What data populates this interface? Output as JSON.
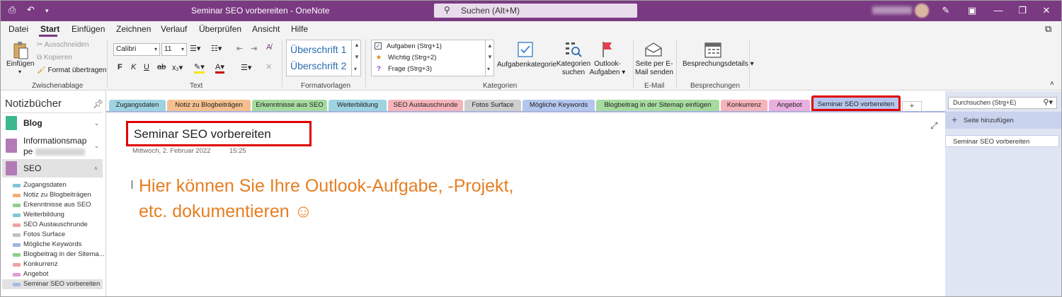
{
  "window": {
    "title": "Seminar SEO vorbereiten  -  OneNote",
    "search_label": "Suchen (Alt+M)"
  },
  "menu": [
    "Datei",
    "Start",
    "Einfügen",
    "Zeichnen",
    "Verlauf",
    "Überprüfen",
    "Ansicht",
    "Hilfe"
  ],
  "ribbon": {
    "clipboard": {
      "paste": "Einfügen",
      "cut": "Ausschneiden",
      "copy": "Kopieren",
      "format_painter": "Format übertragen",
      "group": "Zwischenablage"
    },
    "text": {
      "font": "Calibri",
      "size": "11",
      "group": "Text"
    },
    "styles": {
      "heading1": "Überschrift 1",
      "heading2": "Überschrift 2",
      "group": "Formatvorlagen"
    },
    "tags": {
      "items": [
        "Aufgaben (Strg+1)",
        "Wichtig (Strg+2)",
        "Frage (Strg+3)"
      ],
      "task_tag": "Aufgabenkategorie",
      "find_tags_1": "Kategorien",
      "find_tags_2": "suchen",
      "outlook_1": "Outlook-",
      "outlook_2": "Aufgaben",
      "group": "Kategorien"
    },
    "email": {
      "send_1": "Seite per E-",
      "send_2": "Mail senden",
      "group": "E-Mail"
    },
    "meetings": {
      "details": "Besprechungsdetails",
      "group": "Besprechungen"
    }
  },
  "notebooks": {
    "title": "Notizbücher",
    "items": [
      {
        "name": "Blog",
        "color": "#3cb88f"
      },
      {
        "name_1": "Informationsmap",
        "name_2": "pe",
        "color": "#b27bb6"
      },
      {
        "name": "SEO",
        "color": "#b27bb6"
      }
    ],
    "sections": [
      {
        "label": "Zugangsdaten",
        "color": "#7fc7d9"
      },
      {
        "label": "Notiz zu Blogbeiträgen",
        "color": "#f0b07a"
      },
      {
        "label": "Erkenntnisse aus SEO",
        "color": "#8fcf8a"
      },
      {
        "label": "Weiterbildung",
        "color": "#7fc7d9"
      },
      {
        "label": "SEO Austauschrunde",
        "color": "#f2a0a8"
      },
      {
        "label": "Fotos Surface",
        "color": "#c0c0c0"
      },
      {
        "label": "Mögliche Keywords",
        "color": "#9db4e6"
      },
      {
        "label": "Blogbeitrag in der Sitema...",
        "color": "#8fcf8a"
      },
      {
        "label": "Konkurrenz",
        "color": "#f2a0a8"
      },
      {
        "label": "Angebot",
        "color": "#e49ad6"
      },
      {
        "label": "Seminar SEO vorbereiten",
        "color": "#a8b8e8"
      }
    ]
  },
  "tabs": [
    {
      "label": "Zugangsdaten",
      "color": "#9ed3e2"
    },
    {
      "label": "Notiz zu Blogbeiträgen",
      "color": "#f5c08f"
    },
    {
      "label": "Erkenntnisse aus SEO",
      "color": "#a6dba0"
    },
    {
      "label": "Weiterbildung",
      "color": "#9ed3e2"
    },
    {
      "label": "SEO Austauschrunde",
      "color": "#f5b4ba"
    },
    {
      "label": "Fotos Surface",
      "color": "#cfcfcf"
    },
    {
      "label": "Mögliche Keywords",
      "color": "#b3c6ee"
    },
    {
      "label": "Blogbeitrag in der Sitemap einfügen",
      "color": "#a6dba0"
    },
    {
      "label": "Konkurrenz",
      "color": "#f5b4ba"
    },
    {
      "label": "Angebot",
      "color": "#eab0e0"
    },
    {
      "label": "Seminar SEO vorbereiten",
      "color": "#b8c6ef"
    }
  ],
  "add_tab": "+",
  "page": {
    "title": "Seminar SEO vorbereiten",
    "date": "Mittwoch, 2. Februar 2022",
    "time": "15:25",
    "body_line1": "Hier können Sie Ihre Outlook-Aufgabe, -Projekt,",
    "body_line2": "etc. dokumentieren ☺"
  },
  "pages_panel": {
    "search_placeholder": "Durchsuchen (Strg+E)",
    "add_page": "Seite hinzufügen",
    "pages": [
      "Seminar SEO vorbereiten"
    ]
  },
  "colors": {
    "accent": "#7a3a82",
    "highlight": "#e00000",
    "body_text": "#e67e22"
  }
}
